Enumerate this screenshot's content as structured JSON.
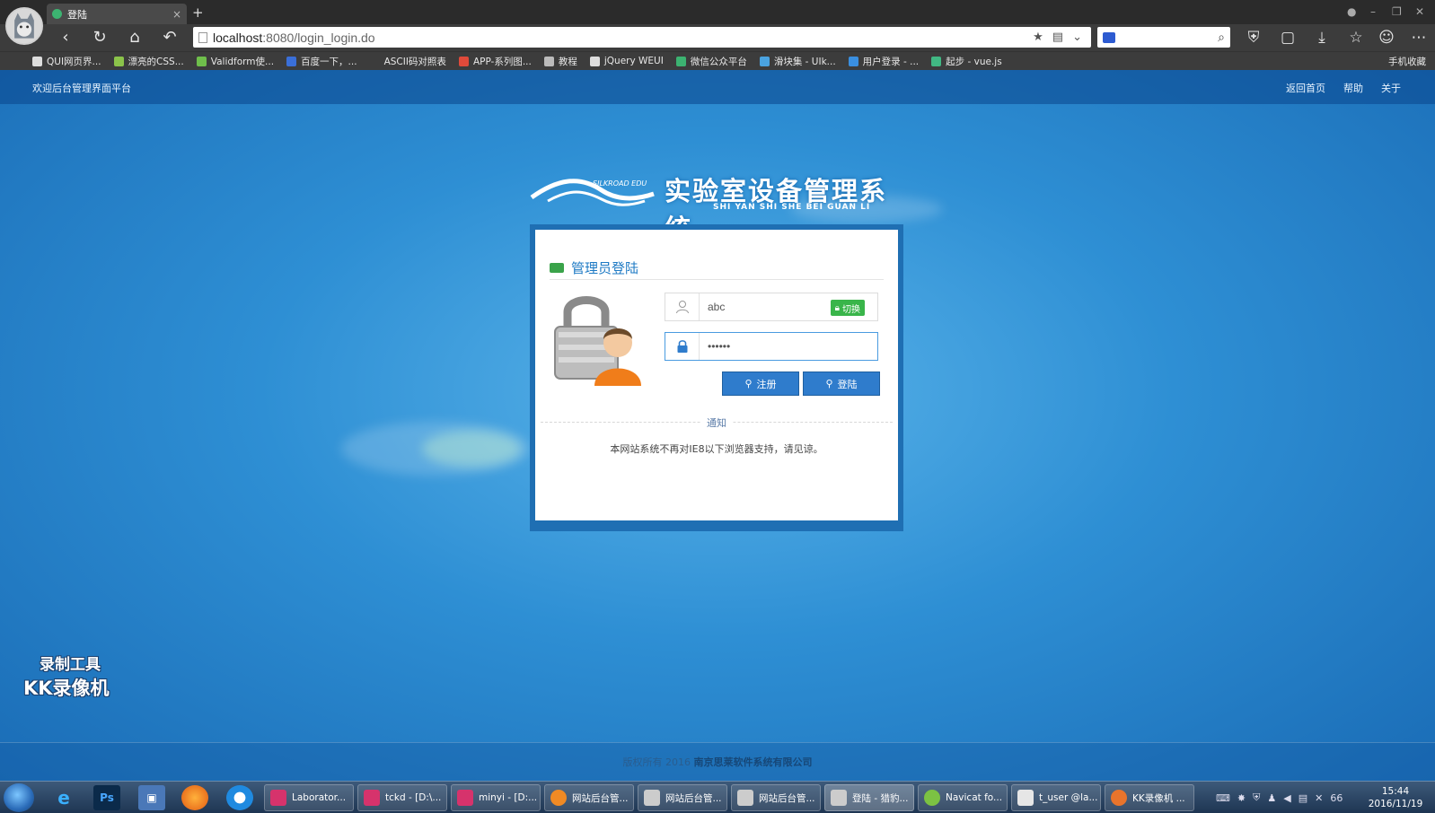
{
  "browser": {
    "tab_title": "登陆",
    "tab_close": "×",
    "new_tab": "+",
    "url_host": "localhost",
    "url_path": ":8080/login_login.do",
    "bookmarks": [
      {
        "label": "QUI网页界...",
        "icon_color": "#dddddd"
      },
      {
        "label": "漂亮的CSS...",
        "icon_color": "#8bc34a"
      },
      {
        "label": "Validform使...",
        "icon_color": "#6fbf4b"
      },
      {
        "label": "百度一下，...",
        "icon_color": "#3a6fd8"
      },
      {
        "label": "ASCII码对照表",
        "icon_color": "#3c3c3c"
      },
      {
        "label": "APP-系列图...",
        "icon_color": "#e04a3a"
      },
      {
        "label": "教程",
        "icon_color": "#bbbbbb"
      },
      {
        "label": "jQuery WEUI",
        "icon_color": "#dddddd"
      },
      {
        "label": "微信公众平台",
        "icon_color": "#3cb371"
      },
      {
        "label": "滑块集 - UIk...",
        "icon_color": "#4aa3e0"
      },
      {
        "label": "用户登录 - ...",
        "icon_color": "#3a8fe0"
      },
      {
        "label": "起步 - vue.js",
        "icon_color": "#41b883"
      }
    ],
    "mobile_bookmarks": "手机收藏"
  },
  "page": {
    "welcome": "欢迎后台管理界面平台",
    "header_links": [
      "返回首页",
      "帮助",
      "关于"
    ],
    "logo_title": "实验室设备管理系统",
    "logo_en": "SHI YAN SHI SHE BEI GUAN LI",
    "logo_brand": "SILKROAD EDU",
    "login": {
      "title": "管理员登陆",
      "username_value": "abc",
      "switch_label": "切换",
      "password_value": "••••••",
      "register_label": "注册",
      "login_label": "登陆",
      "notice_label": "通知",
      "notice_text": "本网站系统不再对IE8以下浏览器支持，请见谅。"
    },
    "watermark_line1": "录制工具",
    "watermark_line2": "KK录像机",
    "copyright_prefix": "版权所有 2016 ",
    "copyright_company": "南京思莱软件系统有限公司"
  },
  "taskbar": {
    "tasks": [
      {
        "label": "Laborator...",
        "icon_color": "#d6336c"
      },
      {
        "label": "tckd - [D:\\...",
        "icon_color": "#d6336c"
      },
      {
        "label": "minyi - [D:...",
        "icon_color": "#d6336c"
      },
      {
        "label": "网站后台管...",
        "icon_color": "#f08a24"
      },
      {
        "label": "网站后台管...",
        "icon_color": "#cccccc"
      },
      {
        "label": "网站后台管...",
        "icon_color": "#cccccc"
      },
      {
        "label": "登陆 - 猎豹...",
        "icon_color": "#cccccc"
      },
      {
        "label": "Navicat fo...",
        "icon_color": "#7cc243"
      },
      {
        "label": "t_user @la...",
        "icon_color": "#e6e6e6"
      },
      {
        "label": "KK录像机 ...",
        "icon_color": "#e8742c"
      }
    ],
    "tray_battery": "66",
    "clock_time": "15:44",
    "clock_date": "2016/11/19"
  },
  "colors": {
    "accent": "#2f7ccc",
    "header_bg": "#1f6fb3",
    "switch_green": "#39b54a"
  }
}
